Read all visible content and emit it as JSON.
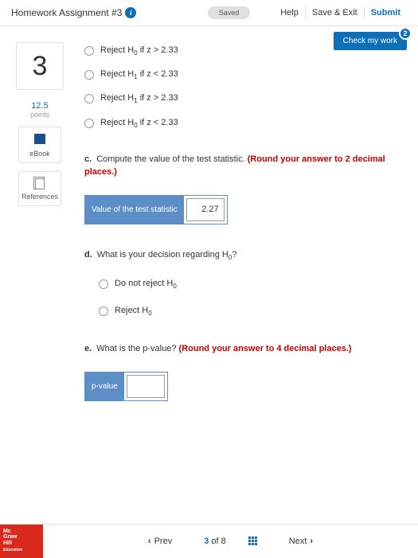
{
  "header": {
    "title": "Homework Assignment #3",
    "saved": "Saved",
    "help": "Help",
    "saveexit": "Save & Exit",
    "submit": "Submit"
  },
  "check": {
    "label": "Check my work",
    "badge": "2"
  },
  "side": {
    "qnum": "3",
    "points": "12.5",
    "points_lbl": "points",
    "ebook": "eBook",
    "refs": "References"
  },
  "options": {
    "a": "Reject H",
    "a_sub": "0",
    "a_tail": " if z > 2.33",
    "b": "Reject H",
    "b_sub": "1",
    "b_tail": " if z < 2.33",
    "c": "Reject H",
    "c_sub": "1",
    "c_tail": " if z > 2.33",
    "d": "Reject H",
    "d_sub": "0",
    "d_tail": " if z < 2.33"
  },
  "partC": {
    "lbl": "c.",
    "text": "Compute the value of the test statistic. ",
    "red": "(Round your answer to 2 decimal places.)",
    "box_lbl": "Value of the test statistic",
    "box_val": "2.27"
  },
  "partD": {
    "lbl": "d.",
    "text": "What is your decision regarding H",
    "sub": "0",
    "tail": "?",
    "opt1": "Do not reject H",
    "opt1_sub": "0",
    "opt2": "Reject H",
    "opt2_sub": "0"
  },
  "partE": {
    "lbl": "e.",
    "text": "What is the p-value? ",
    "red": "(Round your answer to 4 decimal places.)",
    "box_lbl": "p-value",
    "box_val": ""
  },
  "footer": {
    "prev": "Prev",
    "next": "Next",
    "cur": "3",
    "of": "of",
    "total": "8",
    "logo1": "Mc",
    "logo2": "Graw",
    "logo3": "Hill",
    "logo4": "Education"
  }
}
